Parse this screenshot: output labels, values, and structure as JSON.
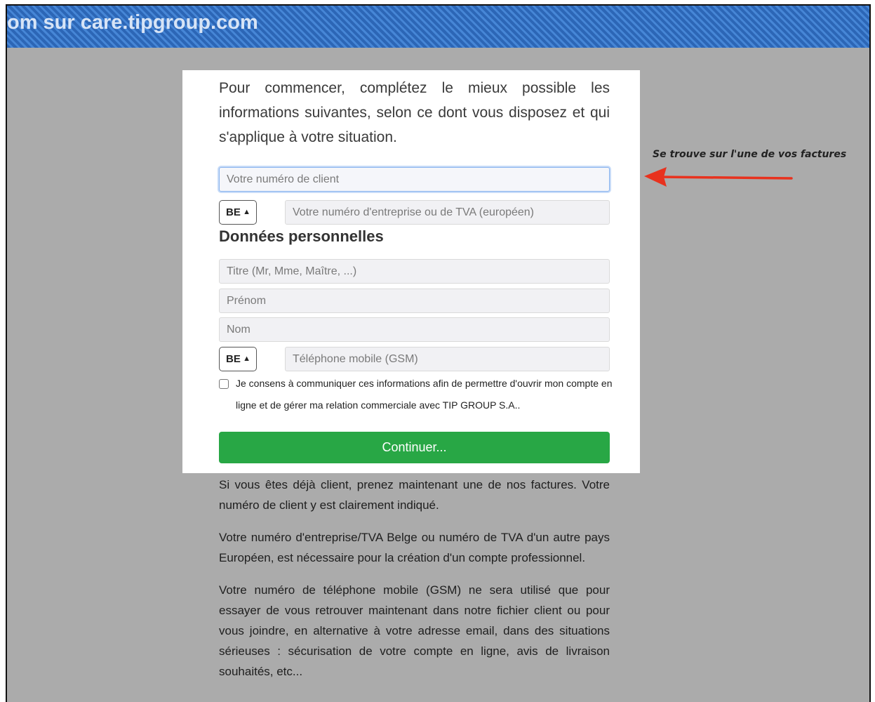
{
  "banner": {
    "title": "om sur care.tipgroup.com"
  },
  "intro": "Pour commencer, complétez le mieux possible les informations suivantes, selon ce dont vous disposez et qui s'applique à votre situation.",
  "form": {
    "client_number_placeholder": "Votre numéro de client",
    "country_select_1": "BE",
    "vat_placeholder": "Votre numéro d'entreprise ou de TVA (européen)",
    "section_title": "Données personnelles",
    "title_placeholder": "Titre (Mr, Mme, Maître, ...)",
    "firstname_placeholder": "Prénom",
    "lastname_placeholder": "Nom",
    "country_select_2": "BE",
    "phone_placeholder": "Téléphone mobile (GSM)",
    "consent_text": "Je consens à communiquer ces informations afin de permettre d'ouvrir mon compte en ligne et de gérer ma relation commerciale avec TIP GROUP S.A..",
    "continue_label": "Continuer..."
  },
  "info_paragraphs": [
    "Si vous êtes déjà client, prenez maintenant une de nos factures. Votre numéro de client y est clairement indiqué.",
    "Votre numéro d'entreprise/TVA Belge ou numéro de TVA d'un autre pays Européen, est nécessaire pour la création d'un compte professionnel.",
    "Votre numéro de téléphone mobile (GSM) ne sera utilisé que pour essayer de vous retrouver maintenant dans notre fichier client ou pour vous joindre, en alternative à votre adresse email, dans des situations sérieuses : sécurisation de votre compte en ligne, avis de livraison souhaités, etc..."
  ],
  "annotation": {
    "text": "Se trouve sur l'une de vos factures",
    "arrow_color": "#e8321e"
  },
  "colors": {
    "banner": "#2f6fc0",
    "continue_button": "#28a745",
    "backdrop": "#ababab"
  }
}
